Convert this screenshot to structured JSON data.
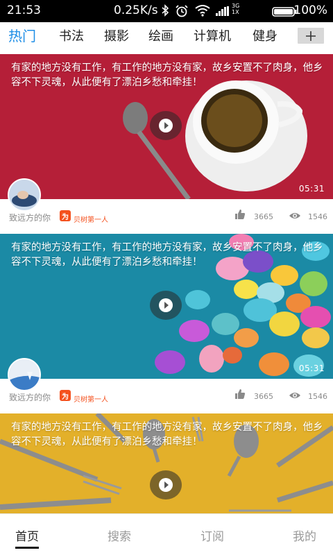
{
  "status_bar": {
    "time": "21:53",
    "speed": "0.25K/s",
    "network_top": "3G",
    "network_bottom": "1X",
    "battery_pct": "100%"
  },
  "tabs": [
    {
      "label": "热门",
      "active": true
    },
    {
      "label": "书法",
      "active": false
    },
    {
      "label": "摄影",
      "active": false
    },
    {
      "label": "绘画",
      "active": false
    },
    {
      "label": "计算机",
      "active": false
    },
    {
      "label": "健身",
      "active": false
    }
  ],
  "add_tab_icon": "plus-icon",
  "cards": [
    {
      "title": "有家的地方没有工作，有工作的地方没有家，故乡安置不了肉身，他乡容不下灵魂，从此便有了漂泊乡愁和牵挂！",
      "duration": "05:31",
      "author": "致远方的你",
      "source_badge": "为",
      "source_name": "贝树第一人",
      "likes": "3665",
      "views": "1546",
      "background_color": "#b8213a"
    },
    {
      "title": "有家的地方没有工作，有工作的地方没有家，故乡安置不了肉身，他乡容不下灵魂，从此便有了漂泊乡愁和牵挂！",
      "duration": "05:31",
      "author": "致远方的你",
      "source_badge": "为",
      "source_name": "贝树第一人",
      "likes": "3665",
      "views": "1546",
      "background_color": "#1a8fa8"
    },
    {
      "title": "有家的地方没有工作，有工作的地方没有家，故乡安置不了肉身，他乡容不下灵魂，从此便有了漂泊乡愁和牵挂！",
      "background_color": "#e5b22a"
    }
  ],
  "bottom_nav": [
    {
      "label": "首页",
      "active": true
    },
    {
      "label": "搜索",
      "active": false
    },
    {
      "label": "订阅",
      "active": false
    },
    {
      "label": "我的",
      "active": false
    }
  ],
  "colors": {
    "accent": "#1e8ee6",
    "source_orange": "#f4511e"
  }
}
